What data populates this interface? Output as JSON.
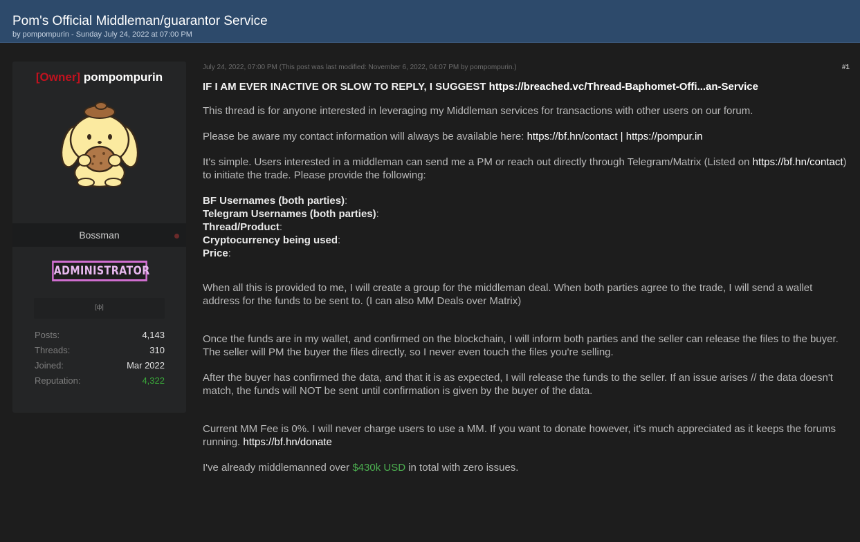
{
  "header": {
    "title": "Pom's Official Middleman/guarantor Service",
    "subtitle": "by pompompurin - Sunday July 24, 2022 at 07:00 PM"
  },
  "user": {
    "role_tag": "[Owner]",
    "name": "pompompurin",
    "title": "Bossman",
    "group_badge": "ADMINISTRATOR",
    "award_icon": "[ф]",
    "stats": [
      {
        "label": "Posts:",
        "value": "4,143"
      },
      {
        "label": "Threads:",
        "value": "310"
      },
      {
        "label": "Joined:",
        "value": "Mar 2022"
      },
      {
        "label": "Reputation:",
        "value": "4,322"
      }
    ],
    "reputation_color": "#3aa83a"
  },
  "post": {
    "meta": "July 24, 2022, 07:00 PM  (This post was last modified: November 6, 2022, 04:07 PM by pompompurin.)",
    "number": "#1",
    "inactive_notice_prefix": "IF I AM EVER INACTIVE OR SLOW TO REPLY, I SUGGEST ",
    "inactive_notice_link": "https://breached.vc/Thread-Baphomet-Offi...an-Service",
    "intro": "This thread is for anyone interested in leveraging my Middleman services for transactions with other users on our forum.",
    "contact_prefix": "Please be aware my contact information will always be available here: ",
    "contact_link_1": "https://bf.hn/contact",
    "contact_separator": " | ",
    "contact_link_2": "https://pompur.in",
    "simple_prefix": "It's simple. Users interested in a middleman can send me a PM or reach out directly through Telegram/Matrix (Listed on ",
    "simple_link": "https://bf.hn/contact",
    "simple_suffix": ") to initiate the trade. Please provide the following:",
    "fields": [
      "BF Usernames (both parties)",
      "Telegram Usernames (both parties)",
      "Thread/Product",
      "Cryptocurrency being used",
      "Price"
    ],
    "field_suffix": ":",
    "group_text": "When all this is provided to me, I will create a group for the middleman deal. When both parties agree to the trade, I will send a wallet address for the funds to be sent to. (I can also MM Deals over Matrix)",
    "funds_text": "Once the funds are in my wallet, and confirmed on the blockchain, I will inform both parties and the seller can release the files to the buyer. The seller will PM the buyer the files directly, so I never even touch the files you're selling.",
    "confirm_text": "After the buyer has confirmed the data, and that it is as expected, I will release the funds to the seller. If an issue arises // the data doesn't match, the funds will NOT be sent until confirmation is given by the buyer of the data.",
    "fee_text": "Current MM Fee is 0%. I will never charge users to use a MM. If you want to donate however, it's much appreciated as it keeps the forums running. ",
    "fee_link": "https://bf.hn/donate",
    "total_prefix": "I've already middlemanned over ",
    "total_amount": "$430k USD",
    "total_suffix": " in total with zero issues."
  }
}
